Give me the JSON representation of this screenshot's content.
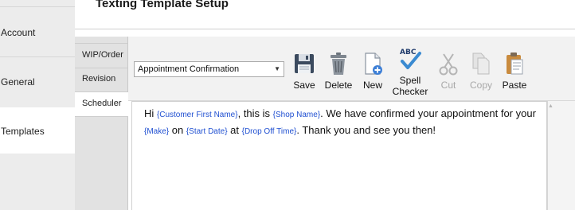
{
  "nav": {
    "items": [
      {
        "label": "Account"
      },
      {
        "label": "General"
      },
      {
        "label": "Templates"
      }
    ]
  },
  "header": {
    "title": "Texting Template Setup"
  },
  "side_tabs": [
    {
      "label": "WIP/Order"
    },
    {
      "label": "Revision"
    },
    {
      "label": "Scheduler"
    }
  ],
  "toolbar": {
    "template_select": {
      "value": "Appointment Confirmation"
    },
    "buttons": {
      "save": "Save",
      "delete": "Delete",
      "new": "New",
      "spell_line1": "Spell",
      "spell_line2": "Checker",
      "cut": "Cut",
      "copy": "Copy",
      "paste": "Paste"
    }
  },
  "editor": {
    "t1": "Hi ",
    "tok_customer": "{Customer First Name}",
    "t2": ", this is ",
    "tok_shop": "{Shop Name}",
    "t3": ". We have confirmed your appointment for your ",
    "tok_make": "{Make}",
    "t4": " on ",
    "tok_start": "{Start Date}",
    "t5": " at ",
    "tok_dropoff": "{Drop Off Time}",
    "t6": ". Thank you and see you then!"
  },
  "icons": {
    "save": "floppy-disk-icon",
    "delete": "trash-can-icon",
    "new": "new-document-icon",
    "spell": "spell-check-icon",
    "cut": "scissors-icon",
    "copy": "copy-icon",
    "paste": "clipboard-icon"
  },
  "colors": {
    "token": "#1f4fd1",
    "disabled": "#a8a8a8",
    "nav_bg": "#ececec",
    "selected_bg": "#ffffff"
  }
}
